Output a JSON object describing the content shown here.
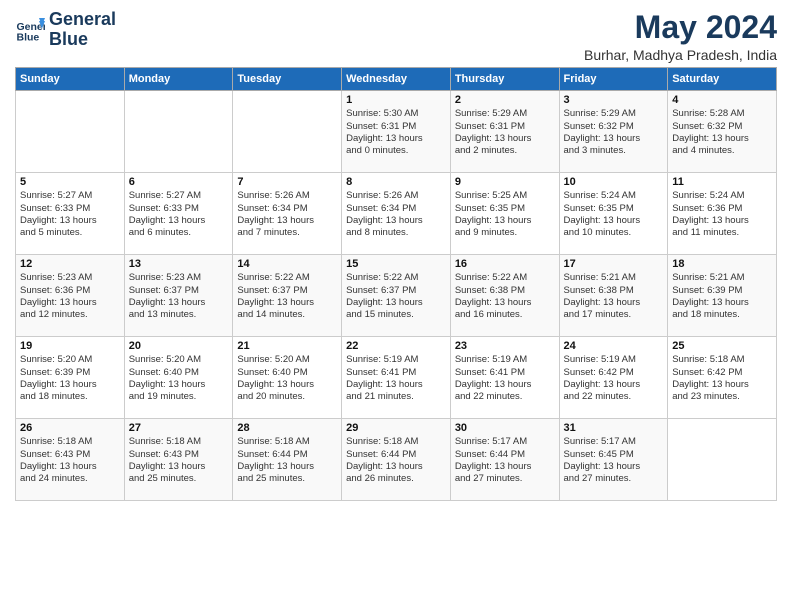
{
  "header": {
    "logo_line1": "General",
    "logo_line2": "Blue",
    "month": "May 2024",
    "location": "Burhar, Madhya Pradesh, India"
  },
  "days_of_week": [
    "Sunday",
    "Monday",
    "Tuesday",
    "Wednesday",
    "Thursday",
    "Friday",
    "Saturday"
  ],
  "weeks": [
    [
      {
        "day": "",
        "info": ""
      },
      {
        "day": "",
        "info": ""
      },
      {
        "day": "",
        "info": ""
      },
      {
        "day": "1",
        "info": "Sunrise: 5:30 AM\nSunset: 6:31 PM\nDaylight: 13 hours\nand 0 minutes."
      },
      {
        "day": "2",
        "info": "Sunrise: 5:29 AM\nSunset: 6:31 PM\nDaylight: 13 hours\nand 2 minutes."
      },
      {
        "day": "3",
        "info": "Sunrise: 5:29 AM\nSunset: 6:32 PM\nDaylight: 13 hours\nand 3 minutes."
      },
      {
        "day": "4",
        "info": "Sunrise: 5:28 AM\nSunset: 6:32 PM\nDaylight: 13 hours\nand 4 minutes."
      }
    ],
    [
      {
        "day": "5",
        "info": "Sunrise: 5:27 AM\nSunset: 6:33 PM\nDaylight: 13 hours\nand 5 minutes."
      },
      {
        "day": "6",
        "info": "Sunrise: 5:27 AM\nSunset: 6:33 PM\nDaylight: 13 hours\nand 6 minutes."
      },
      {
        "day": "7",
        "info": "Sunrise: 5:26 AM\nSunset: 6:34 PM\nDaylight: 13 hours\nand 7 minutes."
      },
      {
        "day": "8",
        "info": "Sunrise: 5:26 AM\nSunset: 6:34 PM\nDaylight: 13 hours\nand 8 minutes."
      },
      {
        "day": "9",
        "info": "Sunrise: 5:25 AM\nSunset: 6:35 PM\nDaylight: 13 hours\nand 9 minutes."
      },
      {
        "day": "10",
        "info": "Sunrise: 5:24 AM\nSunset: 6:35 PM\nDaylight: 13 hours\nand 10 minutes."
      },
      {
        "day": "11",
        "info": "Sunrise: 5:24 AM\nSunset: 6:36 PM\nDaylight: 13 hours\nand 11 minutes."
      }
    ],
    [
      {
        "day": "12",
        "info": "Sunrise: 5:23 AM\nSunset: 6:36 PM\nDaylight: 13 hours\nand 12 minutes."
      },
      {
        "day": "13",
        "info": "Sunrise: 5:23 AM\nSunset: 6:37 PM\nDaylight: 13 hours\nand 13 minutes."
      },
      {
        "day": "14",
        "info": "Sunrise: 5:22 AM\nSunset: 6:37 PM\nDaylight: 13 hours\nand 14 minutes."
      },
      {
        "day": "15",
        "info": "Sunrise: 5:22 AM\nSunset: 6:37 PM\nDaylight: 13 hours\nand 15 minutes."
      },
      {
        "day": "16",
        "info": "Sunrise: 5:22 AM\nSunset: 6:38 PM\nDaylight: 13 hours\nand 16 minutes."
      },
      {
        "day": "17",
        "info": "Sunrise: 5:21 AM\nSunset: 6:38 PM\nDaylight: 13 hours\nand 17 minutes."
      },
      {
        "day": "18",
        "info": "Sunrise: 5:21 AM\nSunset: 6:39 PM\nDaylight: 13 hours\nand 18 minutes."
      }
    ],
    [
      {
        "day": "19",
        "info": "Sunrise: 5:20 AM\nSunset: 6:39 PM\nDaylight: 13 hours\nand 18 minutes."
      },
      {
        "day": "20",
        "info": "Sunrise: 5:20 AM\nSunset: 6:40 PM\nDaylight: 13 hours\nand 19 minutes."
      },
      {
        "day": "21",
        "info": "Sunrise: 5:20 AM\nSunset: 6:40 PM\nDaylight: 13 hours\nand 20 minutes."
      },
      {
        "day": "22",
        "info": "Sunrise: 5:19 AM\nSunset: 6:41 PM\nDaylight: 13 hours\nand 21 minutes."
      },
      {
        "day": "23",
        "info": "Sunrise: 5:19 AM\nSunset: 6:41 PM\nDaylight: 13 hours\nand 22 minutes."
      },
      {
        "day": "24",
        "info": "Sunrise: 5:19 AM\nSunset: 6:42 PM\nDaylight: 13 hours\nand 22 minutes."
      },
      {
        "day": "25",
        "info": "Sunrise: 5:18 AM\nSunset: 6:42 PM\nDaylight: 13 hours\nand 23 minutes."
      }
    ],
    [
      {
        "day": "26",
        "info": "Sunrise: 5:18 AM\nSunset: 6:43 PM\nDaylight: 13 hours\nand 24 minutes."
      },
      {
        "day": "27",
        "info": "Sunrise: 5:18 AM\nSunset: 6:43 PM\nDaylight: 13 hours\nand 25 minutes."
      },
      {
        "day": "28",
        "info": "Sunrise: 5:18 AM\nSunset: 6:44 PM\nDaylight: 13 hours\nand 25 minutes."
      },
      {
        "day": "29",
        "info": "Sunrise: 5:18 AM\nSunset: 6:44 PM\nDaylight: 13 hours\nand 26 minutes."
      },
      {
        "day": "30",
        "info": "Sunrise: 5:17 AM\nSunset: 6:44 PM\nDaylight: 13 hours\nand 27 minutes."
      },
      {
        "day": "31",
        "info": "Sunrise: 5:17 AM\nSunset: 6:45 PM\nDaylight: 13 hours\nand 27 minutes."
      },
      {
        "day": "",
        "info": ""
      }
    ]
  ]
}
